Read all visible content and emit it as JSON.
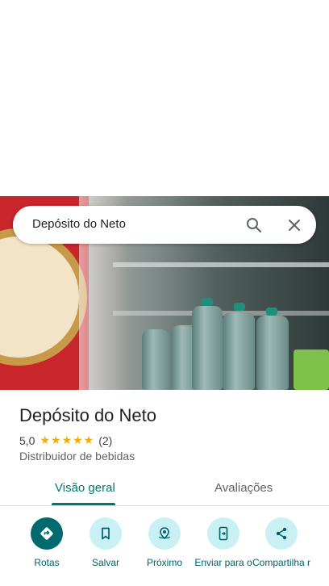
{
  "search": {
    "query": "Depósito do Neto"
  },
  "place": {
    "name": "Depósito do Neto",
    "rating": "5,0",
    "stars": "★★★★★",
    "review_count": "(2)",
    "category": "Distribuidor de bebidas"
  },
  "tabs": [
    {
      "label": "Visão geral",
      "selected": true
    },
    {
      "label": "Avaliações",
      "selected": false
    }
  ],
  "actions": [
    {
      "label": "Rotas",
      "icon": "directions-icon"
    },
    {
      "label": "Salvar",
      "icon": "bookmark-icon"
    },
    {
      "label": "Próximo",
      "icon": "nearby-icon"
    },
    {
      "label": "Enviar para o",
      "icon": "send-to-phone-icon"
    },
    {
      "label": "Compartilha r",
      "icon": "share-icon"
    }
  ],
  "colors": {
    "accent": "#00796b",
    "primary_button": "#006a71",
    "button_bg": "#c9f1f5",
    "star": "#f9ab00"
  }
}
